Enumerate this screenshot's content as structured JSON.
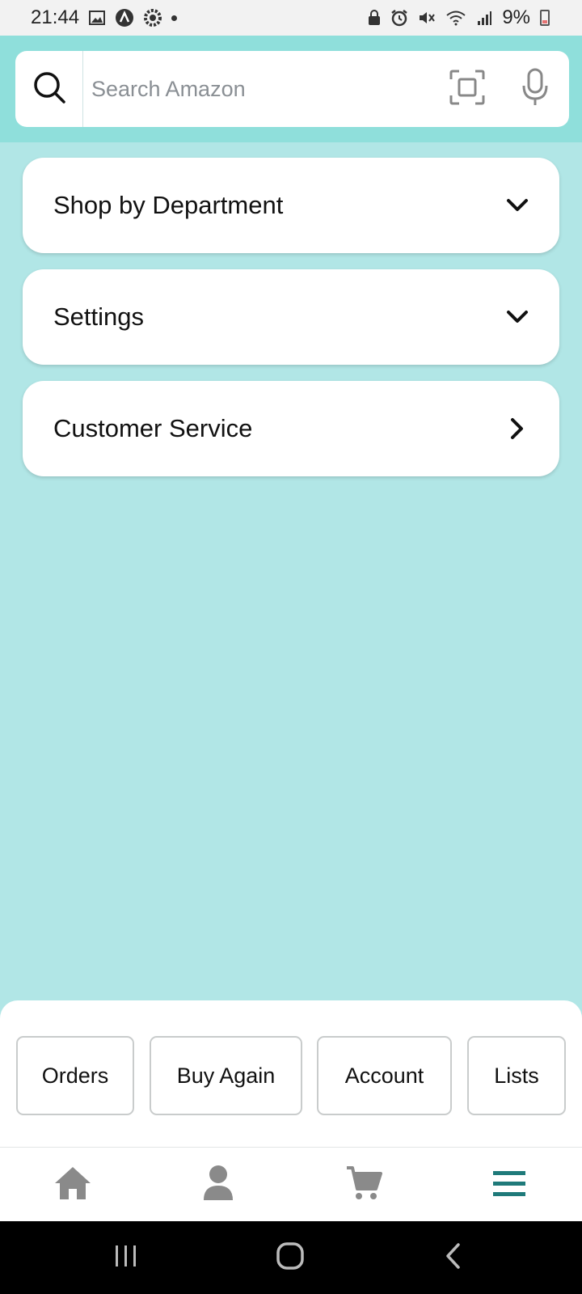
{
  "status_bar": {
    "time": "21:44",
    "battery_text": "9%",
    "left_icons": [
      "gallery-icon",
      "app-a-icon",
      "settings-gear-icon",
      "dot-icon"
    ],
    "right_icons": [
      "lock-icon",
      "alarm-icon",
      "mute-icon",
      "wifi-icon",
      "signal-icon",
      "battery-icon"
    ]
  },
  "header": {
    "background": "#8fdfdb",
    "search": {
      "placeholder": "Search Amazon",
      "value": ""
    },
    "icons": [
      "search-icon",
      "scan-icon",
      "microphone-icon"
    ]
  },
  "menu": {
    "items": [
      {
        "label": "Shop by Department",
        "icon": "chevron-down-icon"
      },
      {
        "label": "Settings",
        "icon": "chevron-down-icon"
      },
      {
        "label": "Customer Service",
        "icon": "chevron-right-icon"
      }
    ]
  },
  "quick_links": {
    "items": [
      {
        "label": "Orders"
      },
      {
        "label": "Buy Again"
      },
      {
        "label": "Account"
      },
      {
        "label": "Lists"
      }
    ]
  },
  "bottom_nav": {
    "items": [
      {
        "icon": "home-icon",
        "active": false
      },
      {
        "icon": "account-icon",
        "active": false
      },
      {
        "icon": "cart-icon",
        "active": false
      },
      {
        "icon": "menu-icon",
        "active": true
      }
    ],
    "active_color": "#1f7a7a",
    "inactive_color": "#8a8a8a"
  },
  "system_nav": {
    "items": [
      "recents-icon",
      "home-button-icon",
      "back-icon"
    ]
  },
  "colors": {
    "page_background": "#b1e6e6"
  }
}
